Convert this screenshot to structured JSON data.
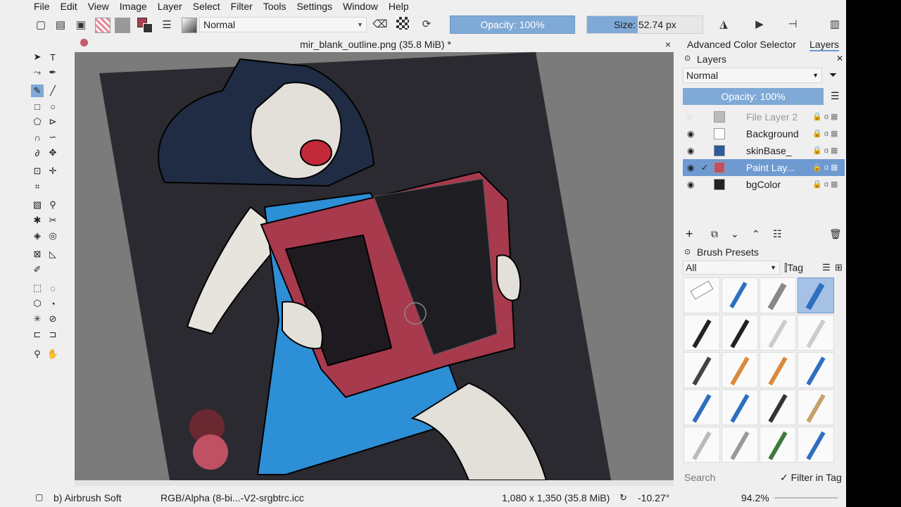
{
  "menu": [
    "File",
    "Edit",
    "View",
    "Image",
    "Layer",
    "Select",
    "Filter",
    "Tools",
    "Settings",
    "Window",
    "Help"
  ],
  "toolbar": {
    "blend_mode": "Normal",
    "opacity_label": "Opacity: 100%",
    "size_label": "Size: 52.74 px",
    "foreground_color": "#a83f4f",
    "background_color": "#777777"
  },
  "document": {
    "title": "mir_blank_outline.png (35.8 MiB) *",
    "close_glyph": "×"
  },
  "dock": {
    "tabs": [
      "Advanced Color Selector",
      "Layers"
    ],
    "layers_title": "Layers",
    "blend_mode": "Normal",
    "opacity_label": "Opacity:  100%",
    "layers": [
      {
        "name": "File Layer 2",
        "visible": false,
        "selected": false
      },
      {
        "name": "Background",
        "visible": true,
        "selected": false
      },
      {
        "name": "skinBase_",
        "visible": true,
        "selected": false
      },
      {
        "name": "Paint Lay...",
        "visible": true,
        "selected": true
      },
      {
        "name": "bgColor",
        "visible": true,
        "selected": false
      }
    ],
    "brush_presets_title": "Brush Presets",
    "brush_filter": "All",
    "tag_label": "Tag",
    "search_placeholder": "Search",
    "filter_in_tag": "Filter in Tag"
  },
  "status": {
    "brush": "b) Airbrush Soft",
    "color_profile": "RGB/Alpha (8-bi...-V2-srgbtrc.icc",
    "image_size": "1,080 x 1,350 (35.8 MiB)",
    "rotation": "-10.27°",
    "zoom": "94.2%"
  },
  "colors": {
    "accent": "#6e9ad1",
    "canvas_bg": "#2a2a30",
    "accordion_red": "#a83a4e",
    "dress_blue": "#2d8fd6"
  }
}
